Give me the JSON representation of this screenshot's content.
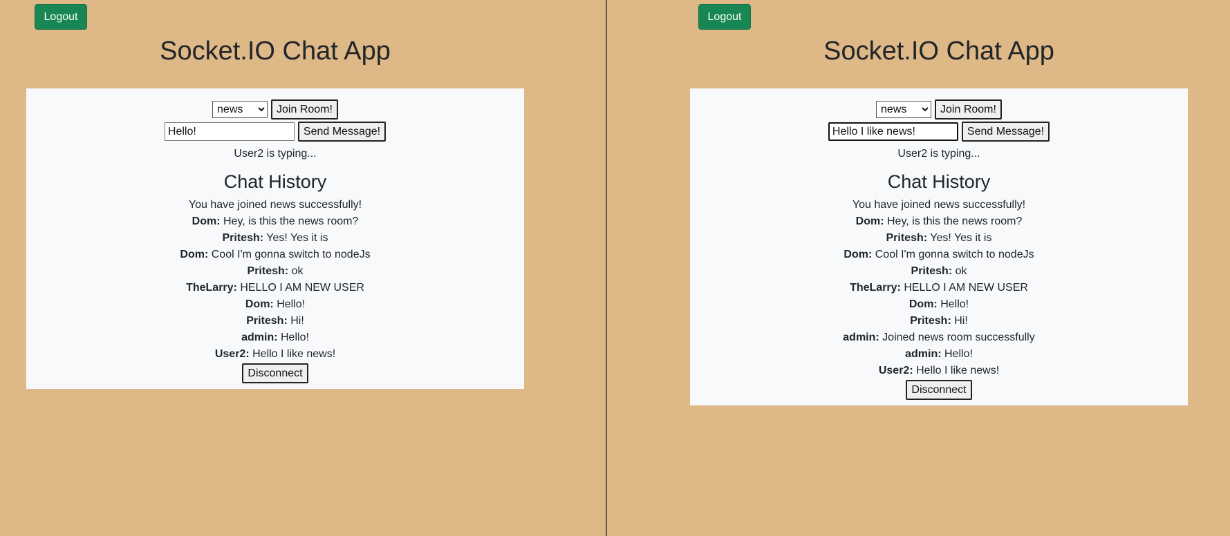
{
  "left": {
    "logout_label": "Logout",
    "title": "Socket.IO Chat App",
    "room_select_value": "news",
    "join_label": "Join Room!",
    "message_value": "Hello!",
    "send_label": "Send Message!",
    "typing_status": "User2 is typing...",
    "history_title": "Chat History",
    "system_message": "You have joined news successfully!",
    "messages": [
      {
        "user": "Dom:",
        "text": "Hey, is this the news room?"
      },
      {
        "user": "Pritesh:",
        "text": "Yes! Yes it is"
      },
      {
        "user": "Dom:",
        "text": "Cool I'm gonna switch to nodeJs"
      },
      {
        "user": "Pritesh:",
        "text": "ok"
      },
      {
        "user": "TheLarry:",
        "text": "HELLO I AM NEW USER"
      },
      {
        "user": "Dom:",
        "text": "Hello!"
      },
      {
        "user": "Pritesh:",
        "text": "Hi!"
      },
      {
        "user": "admin:",
        "text": "Hello!"
      },
      {
        "user": "User2:",
        "text": "Hello I like news!"
      }
    ],
    "disconnect_label": "Disconnect"
  },
  "right": {
    "logout_label": "Logout",
    "title": "Socket.IO Chat App",
    "room_select_value": "news",
    "join_label": "Join Room!",
    "message_value": "Hello I like news!",
    "send_label": "Send Message!",
    "typing_status": "User2 is typing...",
    "history_title": "Chat History",
    "system_message": "You have joined news successfully!",
    "messages": [
      {
        "user": "Dom:",
        "text": "Hey, is this the news room?"
      },
      {
        "user": "Pritesh:",
        "text": "Yes! Yes it is"
      },
      {
        "user": "Dom:",
        "text": "Cool I'm gonna switch to nodeJs"
      },
      {
        "user": "Pritesh:",
        "text": "ok"
      },
      {
        "user": "TheLarry:",
        "text": "HELLO I AM NEW USER"
      },
      {
        "user": "Dom:",
        "text": "Hello!"
      },
      {
        "user": "Pritesh:",
        "text": "Hi!"
      },
      {
        "user": "admin:",
        "text": "Joined news room successfully"
      },
      {
        "user": "admin:",
        "text": "Hello!"
      },
      {
        "user": "User2:",
        "text": "Hello I like news!"
      }
    ],
    "disconnect_label": "Disconnect"
  },
  "colors": {
    "background": "#deb887",
    "card": "#f8f9fa",
    "logout_button": "#198754"
  }
}
